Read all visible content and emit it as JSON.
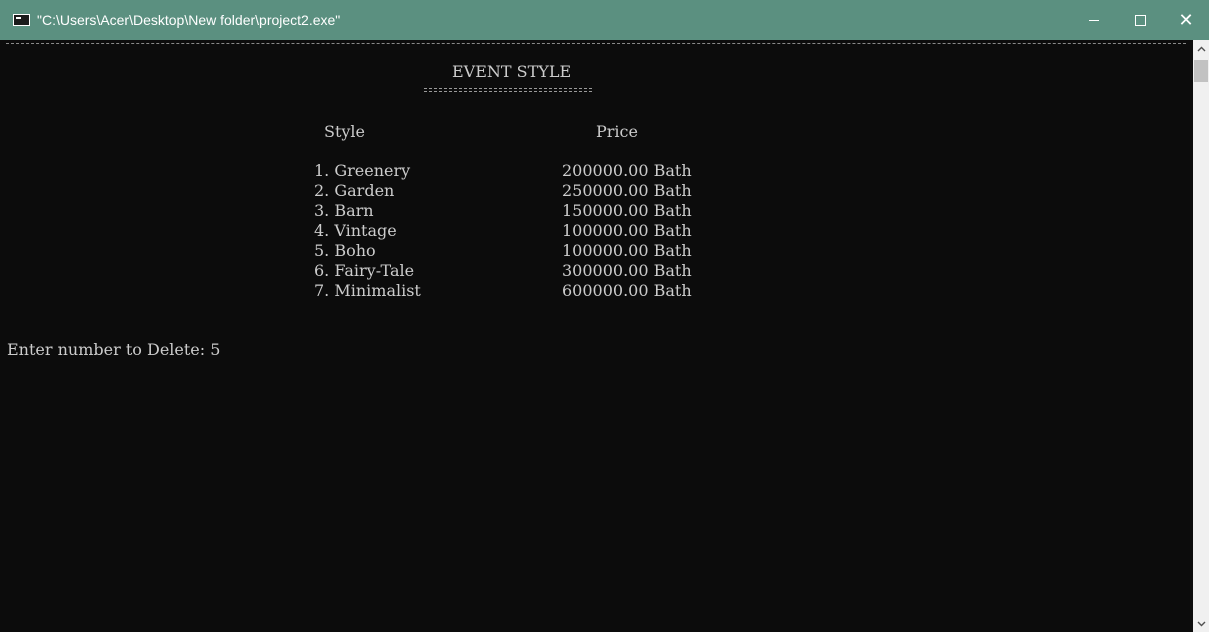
{
  "window": {
    "title": "\"C:\\Users\\Acer\\Desktop\\New folder\\project2.exe\"",
    "minimize_label": "—",
    "close_label": "✕",
    "colors": {
      "titlebar": "#5b9080",
      "console_bg": "#0c0c0c",
      "console_text": "#cccccc"
    }
  },
  "console": {
    "heading": "EVENT STYLE",
    "column_style": "Style",
    "column_price": "Price",
    "items": [
      {
        "name": "1. Greenery",
        "price": "200000.00 Bath"
      },
      {
        "name": "2. Garden",
        "price": "250000.00 Bath"
      },
      {
        "name": "3. Barn",
        "price": "150000.00 Bath"
      },
      {
        "name": "4. Vintage",
        "price": "100000.00 Bath"
      },
      {
        "name": "5. Boho",
        "price": "100000.00 Bath"
      },
      {
        "name": "6. Fairy-Tale",
        "price": "300000.00 Bath"
      },
      {
        "name": "7. Minimalist",
        "price": "600000.00 Bath"
      }
    ],
    "prompt": "Enter number to Delete: 5"
  },
  "scrollbar": {
    "up_icon": "^",
    "down_icon": "v"
  }
}
